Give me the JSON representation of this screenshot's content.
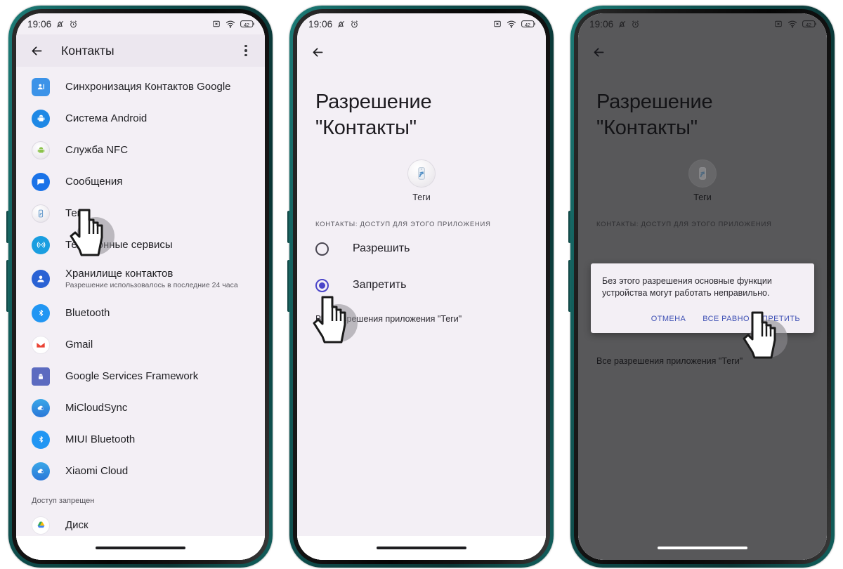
{
  "status_bar": {
    "time": "19:06",
    "icons_left": [
      "bell-muted-icon",
      "alarm-icon"
    ],
    "icons_right": [
      "no-sim-icon",
      "wifi-icon",
      "battery-icon"
    ],
    "battery_level": "42"
  },
  "panel1": {
    "appbar": {
      "back": "back-arrow-icon",
      "title": "Контакты",
      "overflow": "overflow-menu-icon"
    },
    "items": [
      {
        "title": "Синхронизация Контактов Google",
        "sub": "",
        "icon": "google-contacts-sync-icon"
      },
      {
        "title": "Система Android",
        "sub": "",
        "icon": "android-system-icon"
      },
      {
        "title": "Служба NFC",
        "sub": "",
        "icon": "nfc-service-icon"
      },
      {
        "title": "Сообщения",
        "sub": "",
        "icon": "messages-icon"
      },
      {
        "title": "Теги",
        "sub": "",
        "icon": "tags-icon"
      },
      {
        "title": "Телефонные сервисы",
        "sub": "",
        "icon": "telephony-services-icon"
      },
      {
        "title": "Хранилище контактов",
        "sub": "Разрешение использовалось в последние 24 часа",
        "icon": "contacts-storage-icon"
      },
      {
        "title": "Bluetooth",
        "sub": "",
        "icon": "bluetooth-icon"
      },
      {
        "title": "Gmail",
        "sub": "",
        "icon": "gmail-icon"
      },
      {
        "title": "Google Services Framework",
        "sub": "",
        "icon": "google-services-framework-icon"
      },
      {
        "title": "MiCloudSync",
        "sub": "",
        "icon": "micloudsync-icon"
      },
      {
        "title": "MIUI Bluetooth",
        "sub": "",
        "icon": "miui-bluetooth-icon"
      },
      {
        "title": "Xiaomi Cloud",
        "sub": "",
        "icon": "xiaomi-cloud-icon"
      }
    ],
    "denied_section_label": "Доступ запрещен",
    "denied_items": [
      {
        "title": "Диск",
        "sub": "",
        "icon": "google-drive-icon"
      }
    ]
  },
  "panel2": {
    "title": "Разрешение\n\"Контакты\"",
    "title_line1": "Разрешение",
    "title_line2": "\"Контакты\"",
    "app_icon_name": "Теги",
    "section_label": "Контакты: доступ для этого приложения",
    "options": [
      {
        "label": "Разрешить",
        "checked": false
      },
      {
        "label": "Запретить",
        "checked": true
      }
    ],
    "all_permissions_link": "Все разрешения приложения \"Теги\""
  },
  "panel3": {
    "title_line1": "Разрешение",
    "title_line2": "\"Контакты\"",
    "app_icon_name": "Теги",
    "section_label": "Контакты: доступ для этого приложения",
    "all_permissions_link": "Все разрешения приложения \"Теги\"",
    "dialog": {
      "message": "Без этого разрешения основные функции устройства могут работать неправильно.",
      "cancel": "Отмена",
      "confirm": "Все равно запретить"
    }
  },
  "colors": {
    "accent_blue": "#4a45c9",
    "dialog_action": "#3f51b5",
    "screen_bg": "#f3eff5",
    "appbar_bg": "#ece7ef",
    "frame_teal": "#12605d"
  }
}
